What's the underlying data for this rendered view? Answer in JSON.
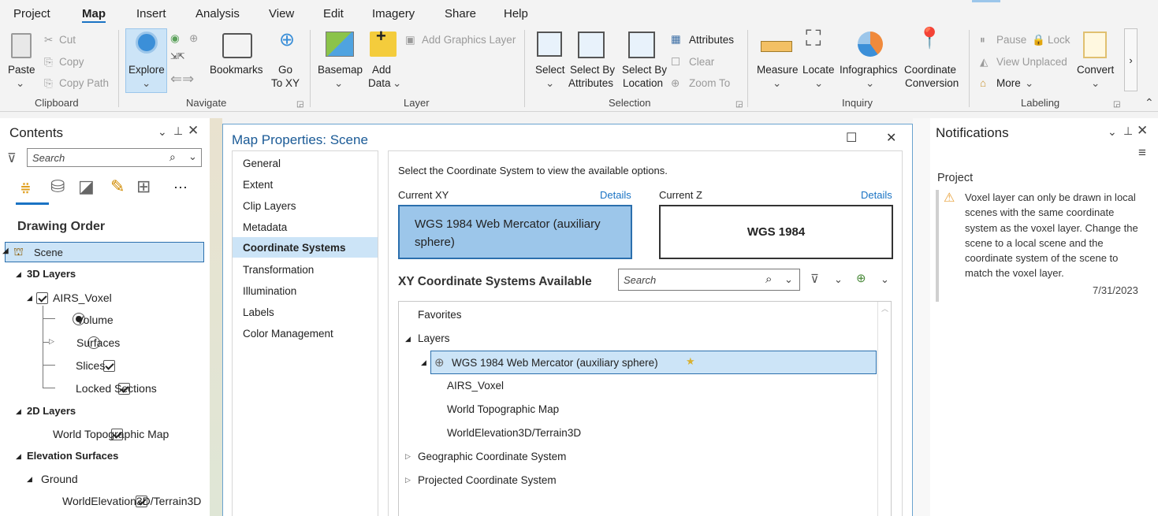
{
  "tabs": [
    "Project",
    "Map",
    "Insert",
    "Analysis",
    "View",
    "Edit",
    "Imagery",
    "Share",
    "Help"
  ],
  "active_tab": "Map",
  "ribbon": {
    "clipboard": {
      "paste": "Paste",
      "cut": "Cut",
      "copy": "Copy",
      "copy_path": "Copy Path",
      "group": "Clipboard"
    },
    "navigate": {
      "explore": "Explore",
      "bookmarks": "Bookmarks",
      "go": "Go",
      "to_xy": "To XY",
      "group": "Navigate"
    },
    "layer": {
      "basemap": "Basemap",
      "add": "Add",
      "data": "Data",
      "add_graphics": "Add Graphics Layer",
      "group": "Layer"
    },
    "selection": {
      "select": "Select",
      "select_by": "Select By",
      "attributes": "Attributes",
      "select_by2": "Select By",
      "location": "Location",
      "attributes_btn": "Attributes",
      "clear": "Clear",
      "zoom_to": "Zoom To",
      "group": "Selection"
    },
    "inquiry": {
      "measure": "Measure",
      "locate": "Locate",
      "infographics": "Infographics",
      "coordinate": "Coordinate",
      "conversion": "Conversion",
      "group": "Inquiry"
    },
    "labeling": {
      "pause": "Pause",
      "lock": "Lock",
      "view_unplaced": "View Unplaced",
      "more": "More",
      "convert": "Convert",
      "group": "Labeling"
    }
  },
  "contents": {
    "title": "Contents",
    "search_placeholder": "Search",
    "drawing_order": "Drawing Order",
    "scene": "Scene",
    "layers_3d": "3D Layers",
    "airs_voxel": "AIRS_Voxel",
    "volume": "Volume",
    "surfaces": "Surfaces",
    "slices": "Slices",
    "locked_sections": "Locked Sections",
    "layers_2d": "2D Layers",
    "world_topo": "World Topographic Map",
    "elevation_surfaces": "Elevation Surfaces",
    "ground": "Ground",
    "world_elevation": "WorldElevation3D/Terrain3D"
  },
  "dialog": {
    "title": "Map Properties: Scene",
    "nav": [
      "General",
      "Extent",
      "Clip Layers",
      "Metadata",
      "Coordinate Systems",
      "Transformation",
      "Illumination",
      "Labels",
      "Color Management"
    ],
    "active_nav": "Coordinate Systems",
    "instruction": "Select the Coordinate System to view the available options.",
    "current_xy_label": "Current XY",
    "details": "Details",
    "current_z_label": "Current Z",
    "current_xy_value": "WGS 1984 Web Mercator (auxiliary sphere)",
    "current_z_value": "WGS 1984",
    "available_title": "XY Coordinate Systems Available",
    "search_placeholder": "Search",
    "tree": {
      "favorites": "Favorites",
      "layers": "Layers",
      "selected": "WGS 1984 Web Mercator (auxiliary sphere)",
      "children": [
        "AIRS_Voxel",
        "World Topographic Map",
        "WorldElevation3D/Terrain3D"
      ],
      "geographic": "Geographic Coordinate System",
      "projected": "Projected Coordinate System"
    }
  },
  "notifications": {
    "title": "Notifications",
    "section": "Project",
    "message": "Voxel layer can only be drawn in local scenes with the same coordinate system as the voxel layer. Change the scene to a local scene and the coordinate system of the scene to match the voxel layer.",
    "date": "7/31/2023"
  },
  "colors": {
    "accent": "#1a73c4",
    "selection": "#cce4f7",
    "selection_border": "#2b6fad",
    "dialog_border": "#6aa3cf",
    "warning": "#e8a33d"
  }
}
